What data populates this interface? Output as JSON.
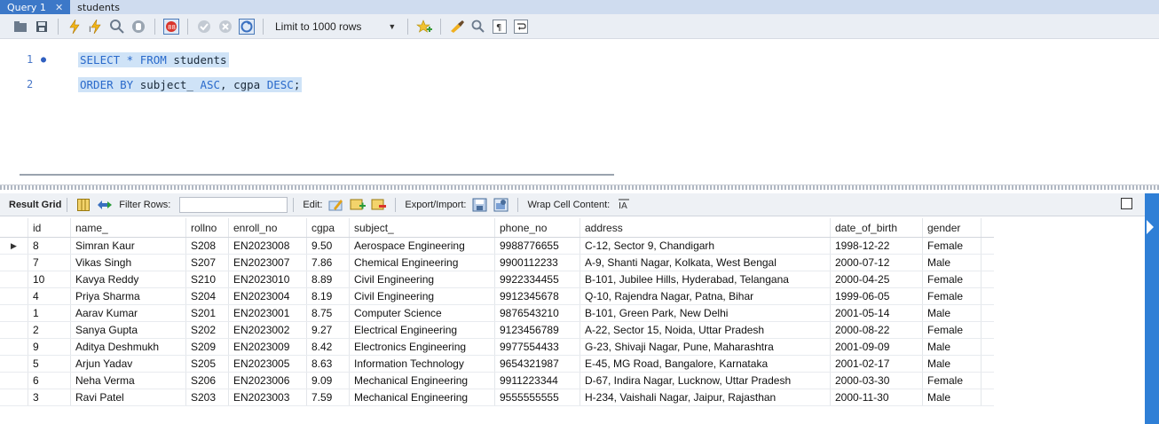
{
  "tabs": [
    {
      "label": "Query 1",
      "active": true
    },
    {
      "label": "students",
      "active": false
    }
  ],
  "toolbar": {
    "limit_label": "Limit to 1000 rows"
  },
  "editor": {
    "lines": [
      {
        "number": "1",
        "code": [
          {
            "t": "SELECT * FROM ",
            "k": "kw"
          },
          {
            "t": "students",
            "k": "tx"
          }
        ]
      },
      {
        "number": "2",
        "code": [
          {
            "t": "ORDER BY ",
            "k": "kw"
          },
          {
            "t": "subject_ ",
            "k": "tx"
          },
          {
            "t": "ASC",
            "k": "kw"
          },
          {
            "t": ", cgpa ",
            "k": "tx"
          },
          {
            "t": "DESC",
            "k": "kw"
          },
          {
            "t": ";",
            "k": "tx"
          }
        ]
      }
    ]
  },
  "result_toolbar": {
    "result_grid": "Result Grid",
    "filter_rows": "Filter Rows:",
    "edit": "Edit:",
    "export_import": "Export/Import:",
    "wrap_cell": "Wrap Cell Content:"
  },
  "grid": {
    "columns": [
      "id",
      "name_",
      "rollno",
      "enroll_no",
      "cgpa",
      "subject_",
      "phone_no",
      "address",
      "date_of_birth",
      "gender"
    ],
    "rows": [
      [
        "8",
        "Simran Kaur",
        "S208",
        "EN2023008",
        "9.50",
        "Aerospace Engineering",
        "9988776655",
        "C-12, Sector 9, Chandigarh",
        "1998-12-22",
        "Female"
      ],
      [
        "7",
        "Vikas Singh",
        "S207",
        "EN2023007",
        "7.86",
        "Chemical Engineering",
        "9900112233",
        "A-9, Shanti Nagar, Kolkata, West Bengal",
        "2000-07-12",
        "Male"
      ],
      [
        "10",
        "Kavya Reddy",
        "S210",
        "EN2023010",
        "8.89",
        "Civil Engineering",
        "9922334455",
        "B-101, Jubilee Hills, Hyderabad, Telangana",
        "2000-04-25",
        "Female"
      ],
      [
        "4",
        "Priya Sharma",
        "S204",
        "EN2023004",
        "8.19",
        "Civil Engineering",
        "9912345678",
        "Q-10, Rajendra Nagar, Patna, Bihar",
        "1999-06-05",
        "Female"
      ],
      [
        "1",
        "Aarav Kumar",
        "S201",
        "EN2023001",
        "8.75",
        "Computer Science",
        "9876543210",
        "B-101, Green Park, New Delhi",
        "2001-05-14",
        "Male"
      ],
      [
        "2",
        "Sanya Gupta",
        "S202",
        "EN2023002",
        "9.27",
        "Electrical Engineering",
        "9123456789",
        "A-22, Sector 15, Noida, Uttar Pradesh",
        "2000-08-22",
        "Female"
      ],
      [
        "9",
        "Aditya Deshmukh",
        "S209",
        "EN2023009",
        "8.42",
        "Electronics Engineering",
        "9977554433",
        "G-23, Shivaji Nagar, Pune, Maharashtra",
        "2001-09-09",
        "Male"
      ],
      [
        "5",
        "Arjun Yadav",
        "S205",
        "EN2023005",
        "8.63",
        "Information Technology",
        "9654321987",
        "E-45, MG Road, Bangalore, Karnataka",
        "2001-02-17",
        "Male"
      ],
      [
        "6",
        "Neha Verma",
        "S206",
        "EN2023006",
        "9.09",
        "Mechanical Engineering",
        "9911223344",
        "D-67, Indira Nagar, Lucknow, Uttar Pradesh",
        "2000-03-30",
        "Female"
      ],
      [
        "3",
        "Ravi Patel",
        "S203",
        "EN2023003",
        "7.59",
        "Mechanical Engineering",
        "9555555555",
        "H-234, Vaishali Nagar, Jaipur, Rajasthan",
        "2000-11-30",
        "Male"
      ]
    ],
    "selected_row_marker": "▶"
  },
  "colors": {
    "tab_active": "#3c78c8",
    "tabbar": "#cfdcef",
    "keyword": "#2a6acb",
    "selection": "#cfe3f7",
    "side_panel": "#2f7fd6"
  }
}
